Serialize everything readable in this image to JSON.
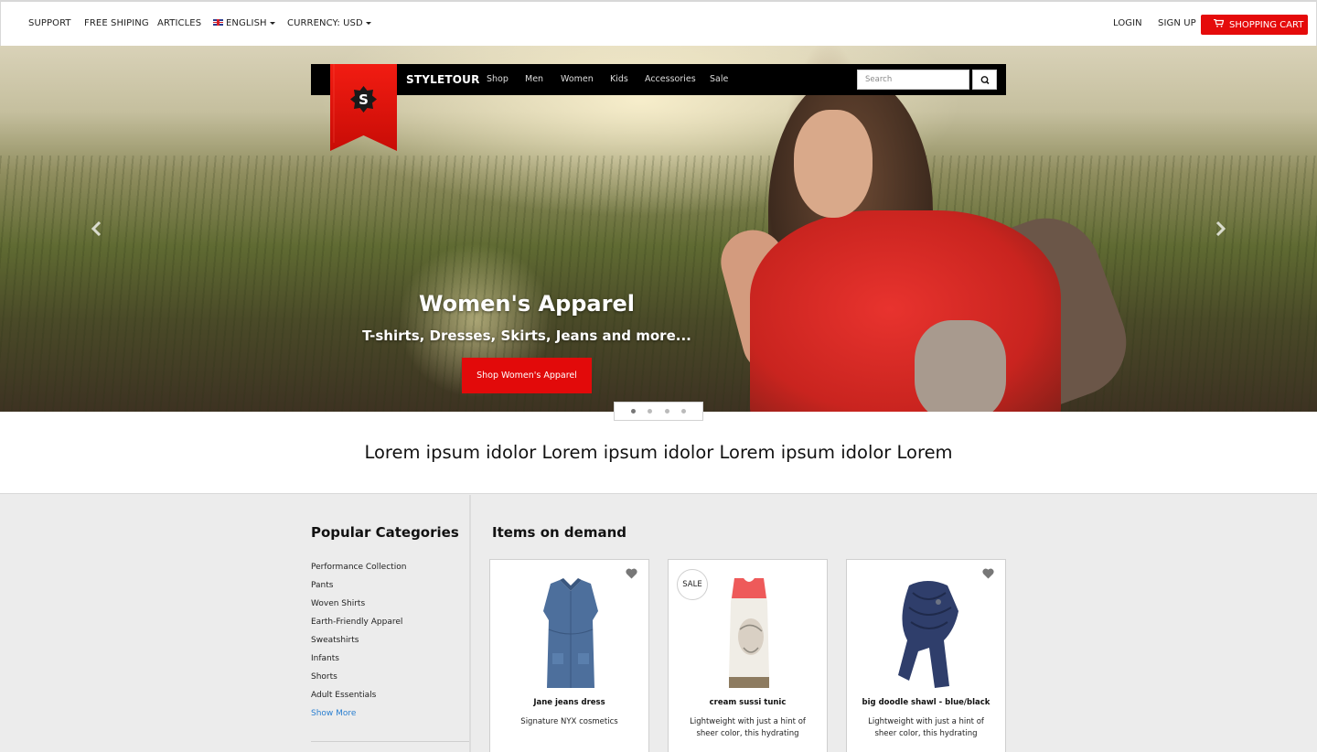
{
  "topbar": {
    "support": "SUPPORT",
    "free_shipping": "FREE SHIPING",
    "articles": "ARTICLES",
    "language": "ENGLISH",
    "currency": "CURRENCY: USD",
    "login": "LOGIN",
    "signup": "SIGN UP",
    "cart": "SHOPPING CART"
  },
  "nav": {
    "logo_letter": "S",
    "brand": "STYLETOUR",
    "links": [
      "Shop",
      "Men",
      "Women",
      "Kids",
      "Accessories",
      "Sale"
    ],
    "search_placeholder": "Search"
  },
  "hero": {
    "title": "Women's Apparel",
    "subtitle": "T-shirts, Dresses, Skirts, Jeans and more...",
    "button": "Shop Women's Apparel",
    "slide_count": 4,
    "active_slide": 1
  },
  "tagline": "Lorem ipsum idolor Lorem ipsum idolor Lorem ipsum idolor Lorem",
  "categories": {
    "title": "Popular Categories",
    "items": [
      "Performance Collection",
      "Pants",
      "Woven Shirts",
      "Earth-Friendly Apparel",
      "Sweatshirts",
      "Infants",
      "Shorts",
      "Adult Essentials"
    ],
    "show_more": "Show More"
  },
  "items": {
    "title": "Items on demand",
    "products": [
      {
        "name": "Jane jeans dress",
        "desc": "Signature NYX cosmetics",
        "badge": "",
        "image": "denim-dress"
      },
      {
        "name": "cream sussi tunic",
        "desc": "Lightweight with just a hint of sheer color, this hydrating",
        "badge": "SALE",
        "image": "printed-tunic"
      },
      {
        "name": "big doodle shawl - blue/black",
        "desc": "Lightweight with just a hint of sheer color, this hydrating",
        "badge": "",
        "image": "blue-shawl"
      }
    ]
  },
  "colors": {
    "accent_red": "#e50b0b",
    "nav_bg": "#000000",
    "link_blue": "#2a7fd0",
    "section_bg": "#ececec"
  }
}
